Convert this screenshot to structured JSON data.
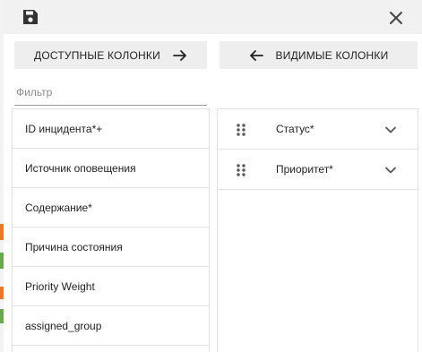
{
  "toolbar": {
    "save_icon": "save-icon",
    "close_icon": "close-icon"
  },
  "available": {
    "header_label": "ДОСТУПНЫЕ КОЛОНКИ",
    "filter_placeholder": "Фильтр",
    "items": [
      "ID инцидента*+",
      "Источник оповещения",
      "Содержание*",
      "Причина состояния",
      "Priority Weight",
      "assigned_group"
    ]
  },
  "visible": {
    "header_label": "ВИДИМЫЕ КОЛОНКИ",
    "items": [
      "Статус*",
      "Приоритет*"
    ]
  },
  "colors": {
    "background_strip": [
      "#f3f3f3",
      "#e97a2a",
      "#6aa84f",
      "#e97a2a",
      "#6aa84f",
      "#f3f3f3"
    ]
  }
}
